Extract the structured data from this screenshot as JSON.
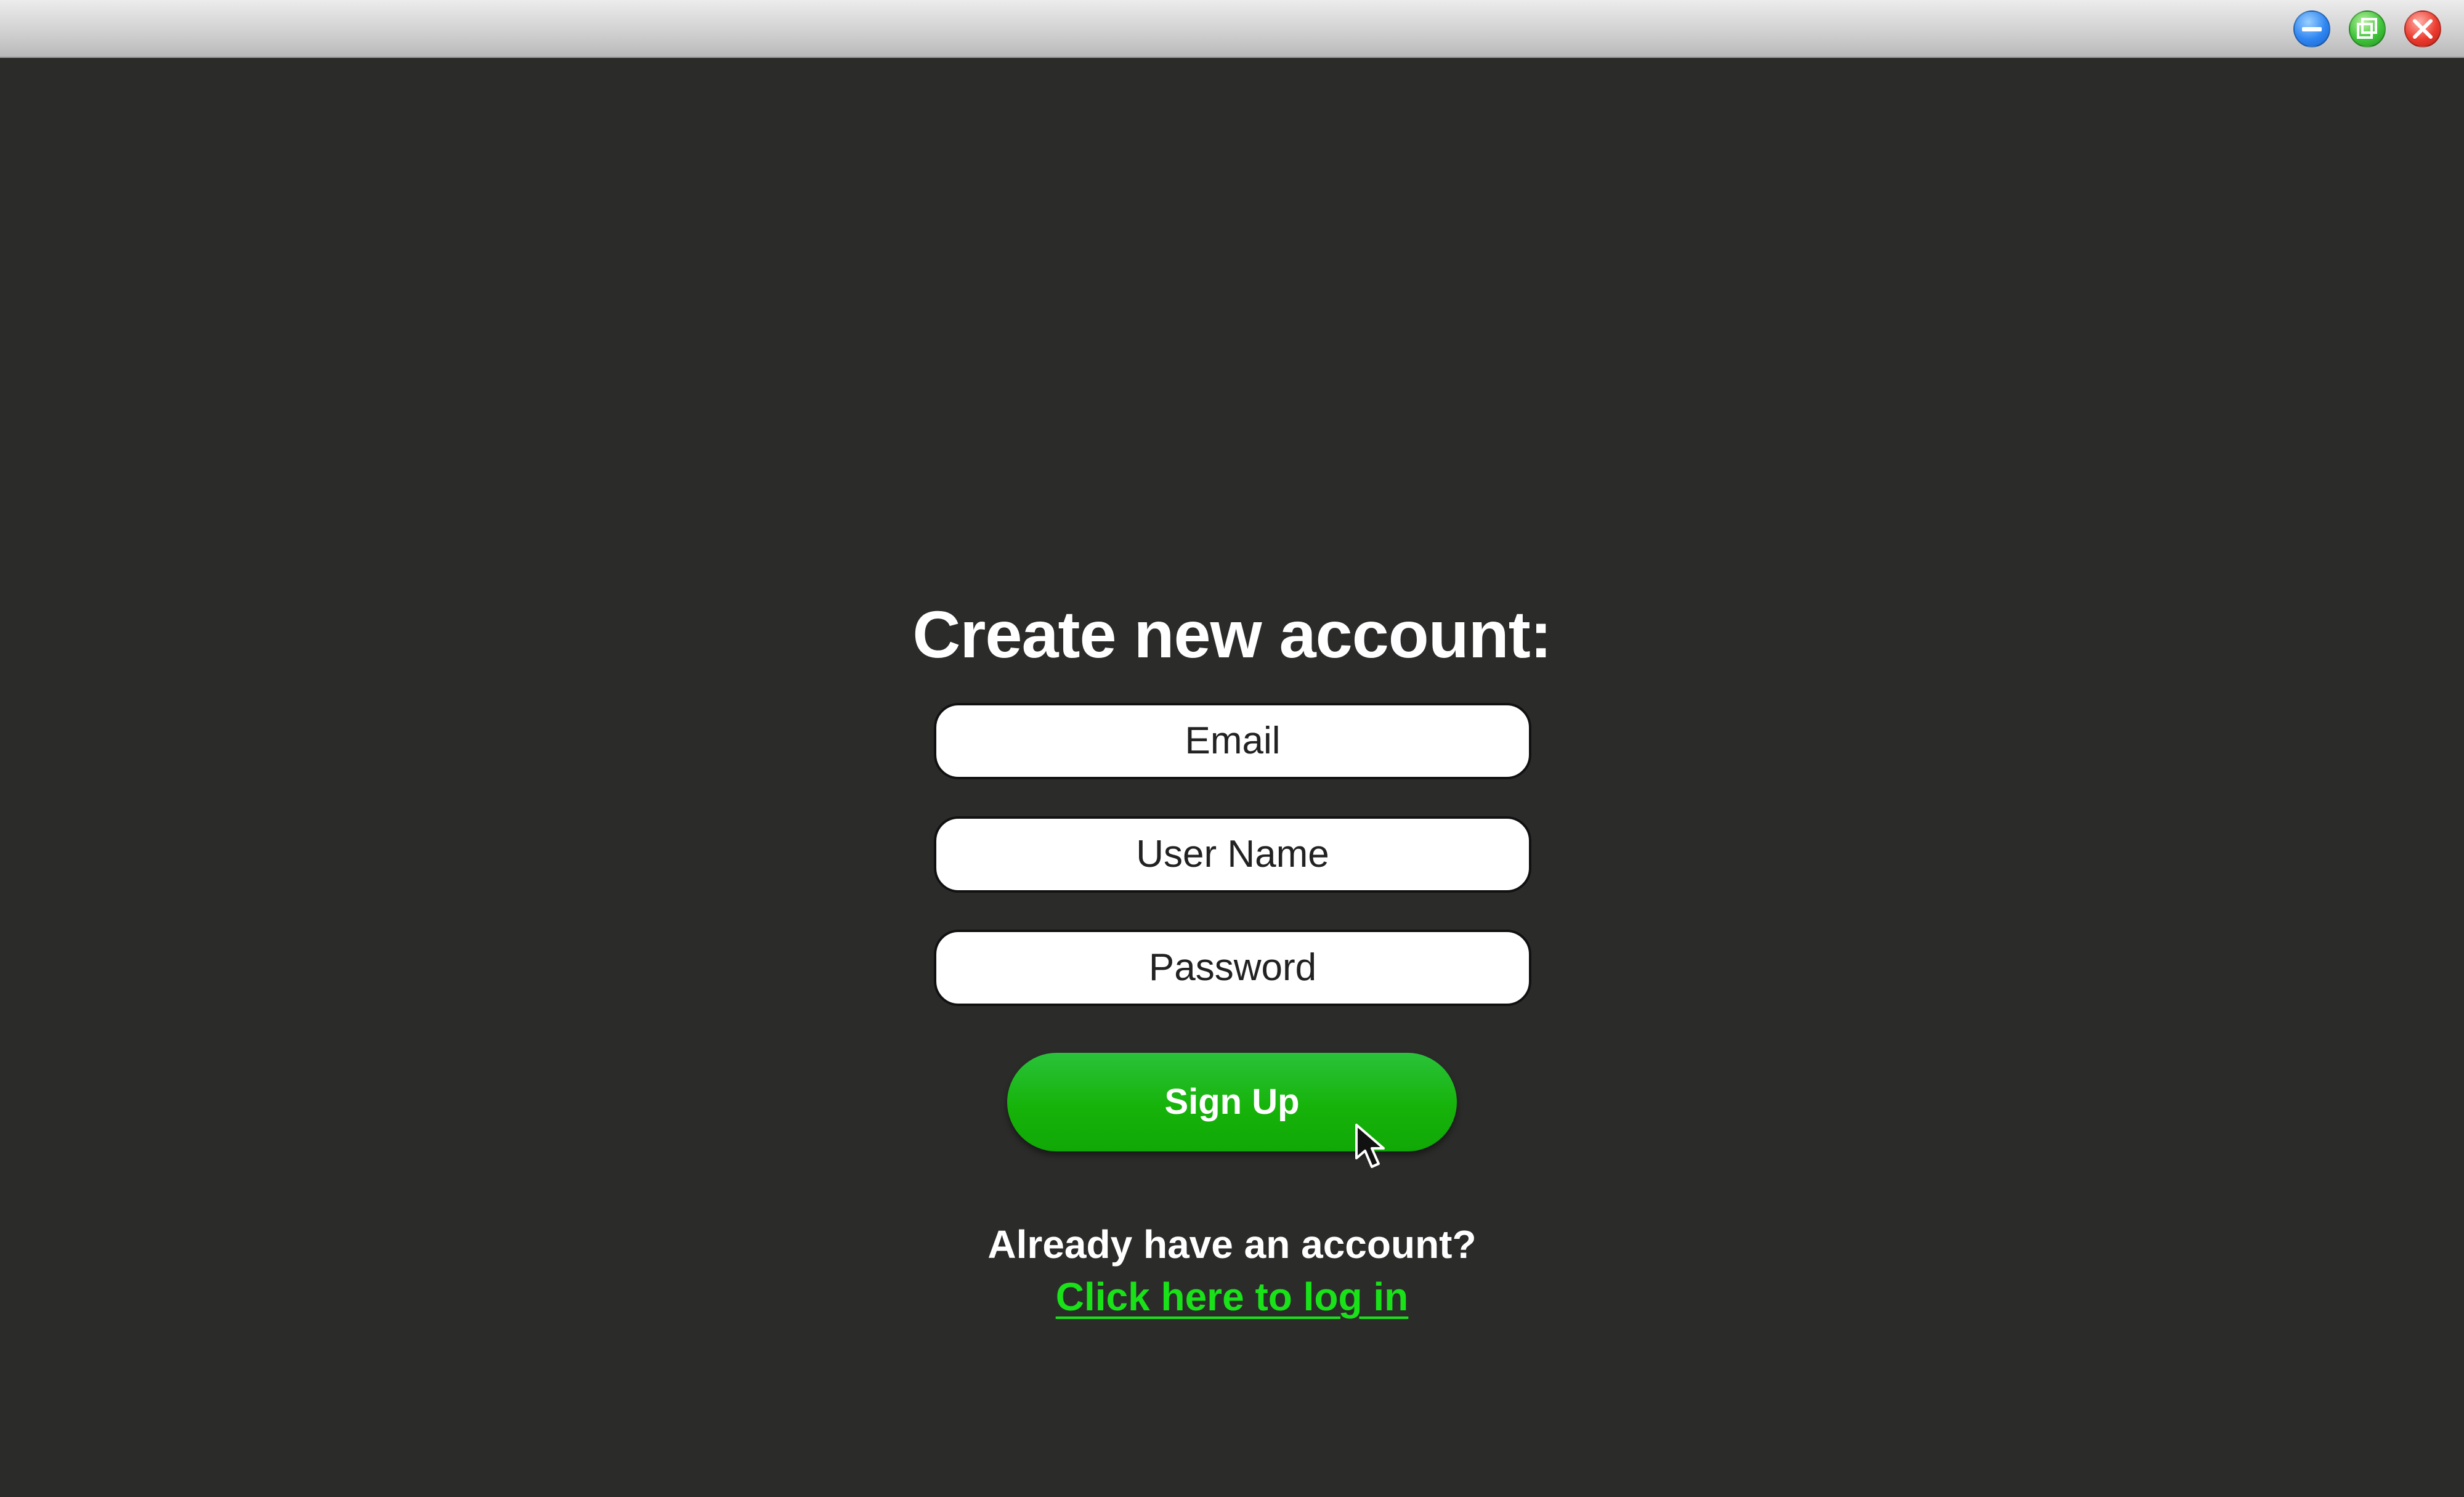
{
  "window": {
    "controls": [
      {
        "name": "minimize-icon",
        "color": "#2f86f2"
      },
      {
        "name": "maximize-icon",
        "color": "#3fc43a"
      },
      {
        "name": "close-icon",
        "color": "#ec3b2f"
      }
    ]
  },
  "form": {
    "title": "Create new account:",
    "email_placeholder": "Email",
    "username_placeholder": "User Name",
    "password_placeholder": "Password",
    "submit_label": "Sign Up"
  },
  "footer": {
    "prompt": "Already have an account?",
    "login_link": "Click here to log in"
  },
  "colors": {
    "background": "#2b2c2a",
    "accent": "#16b30a",
    "link": "#19e219"
  }
}
